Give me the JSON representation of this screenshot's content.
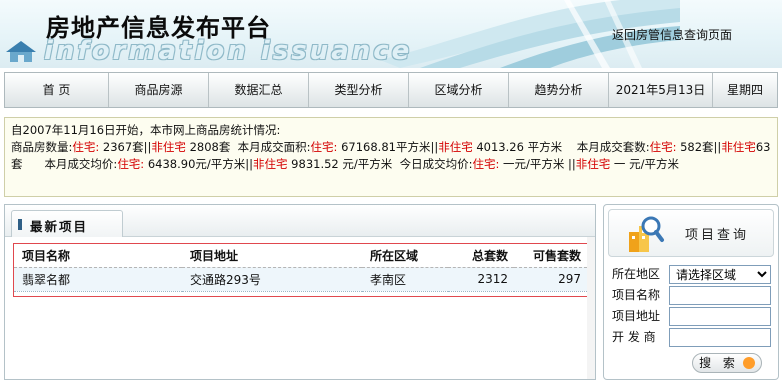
{
  "banner": {
    "title_cn": "房地产信息发布平台",
    "title_en": "information issuance",
    "return_link": "返回房管信息查询页面"
  },
  "nav": {
    "items": [
      "首 页",
      "商品房源",
      "数据汇总",
      "类型分析",
      "区域分析",
      "趋势分析"
    ],
    "date": "2021年5月13日",
    "weekday": "星期四"
  },
  "stats": {
    "intro": "自2007年11月16日开始，本市网上商品房统计情况:",
    "sale_count_label": "商品房数量:",
    "residential_label": "住宅:",
    "nonresidential_label": "非住宅",
    "sale_res": "2367套||",
    "sale_nonres": " 2808套",
    "month_area_label": "本月成交面积:",
    "month_area_res": " 67168.81平方米||",
    "month_area_nonres": " 4013.26 平方米",
    "month_sets_label": "本月成交套数:",
    "month_sets_res": " 582套||",
    "month_sets_nonres": "63套",
    "month_price_label": "本月成交均价:",
    "month_price_res": " 6438.90元/平方米||",
    "month_price_nonres": " 9831.52 元/平方米",
    "today_price_label": "今日成交均价:",
    "today_price_res": " 一元/平方米 ||",
    "today_price_nonres": " 一 元/平方米"
  },
  "latest": {
    "title": "最新项目",
    "columns": [
      "项目名称",
      "项目地址",
      "所在区域",
      "总套数",
      "可售套数"
    ],
    "rows": [
      [
        "翡翠名都",
        "交通路293号",
        "孝南区",
        "2312",
        "297"
      ]
    ]
  },
  "query": {
    "title": "项目查询",
    "district_label": "所在地区",
    "district_selected": "请选择区域",
    "name_label": "项目名称",
    "address_label": "项目地址",
    "developer_label": "开 发 商",
    "search_button": "搜 索"
  },
  "colors": {
    "accent_red": "#d40000",
    "nav_border": "#aeb9bd",
    "stats_bg": "#fdfdf0"
  }
}
